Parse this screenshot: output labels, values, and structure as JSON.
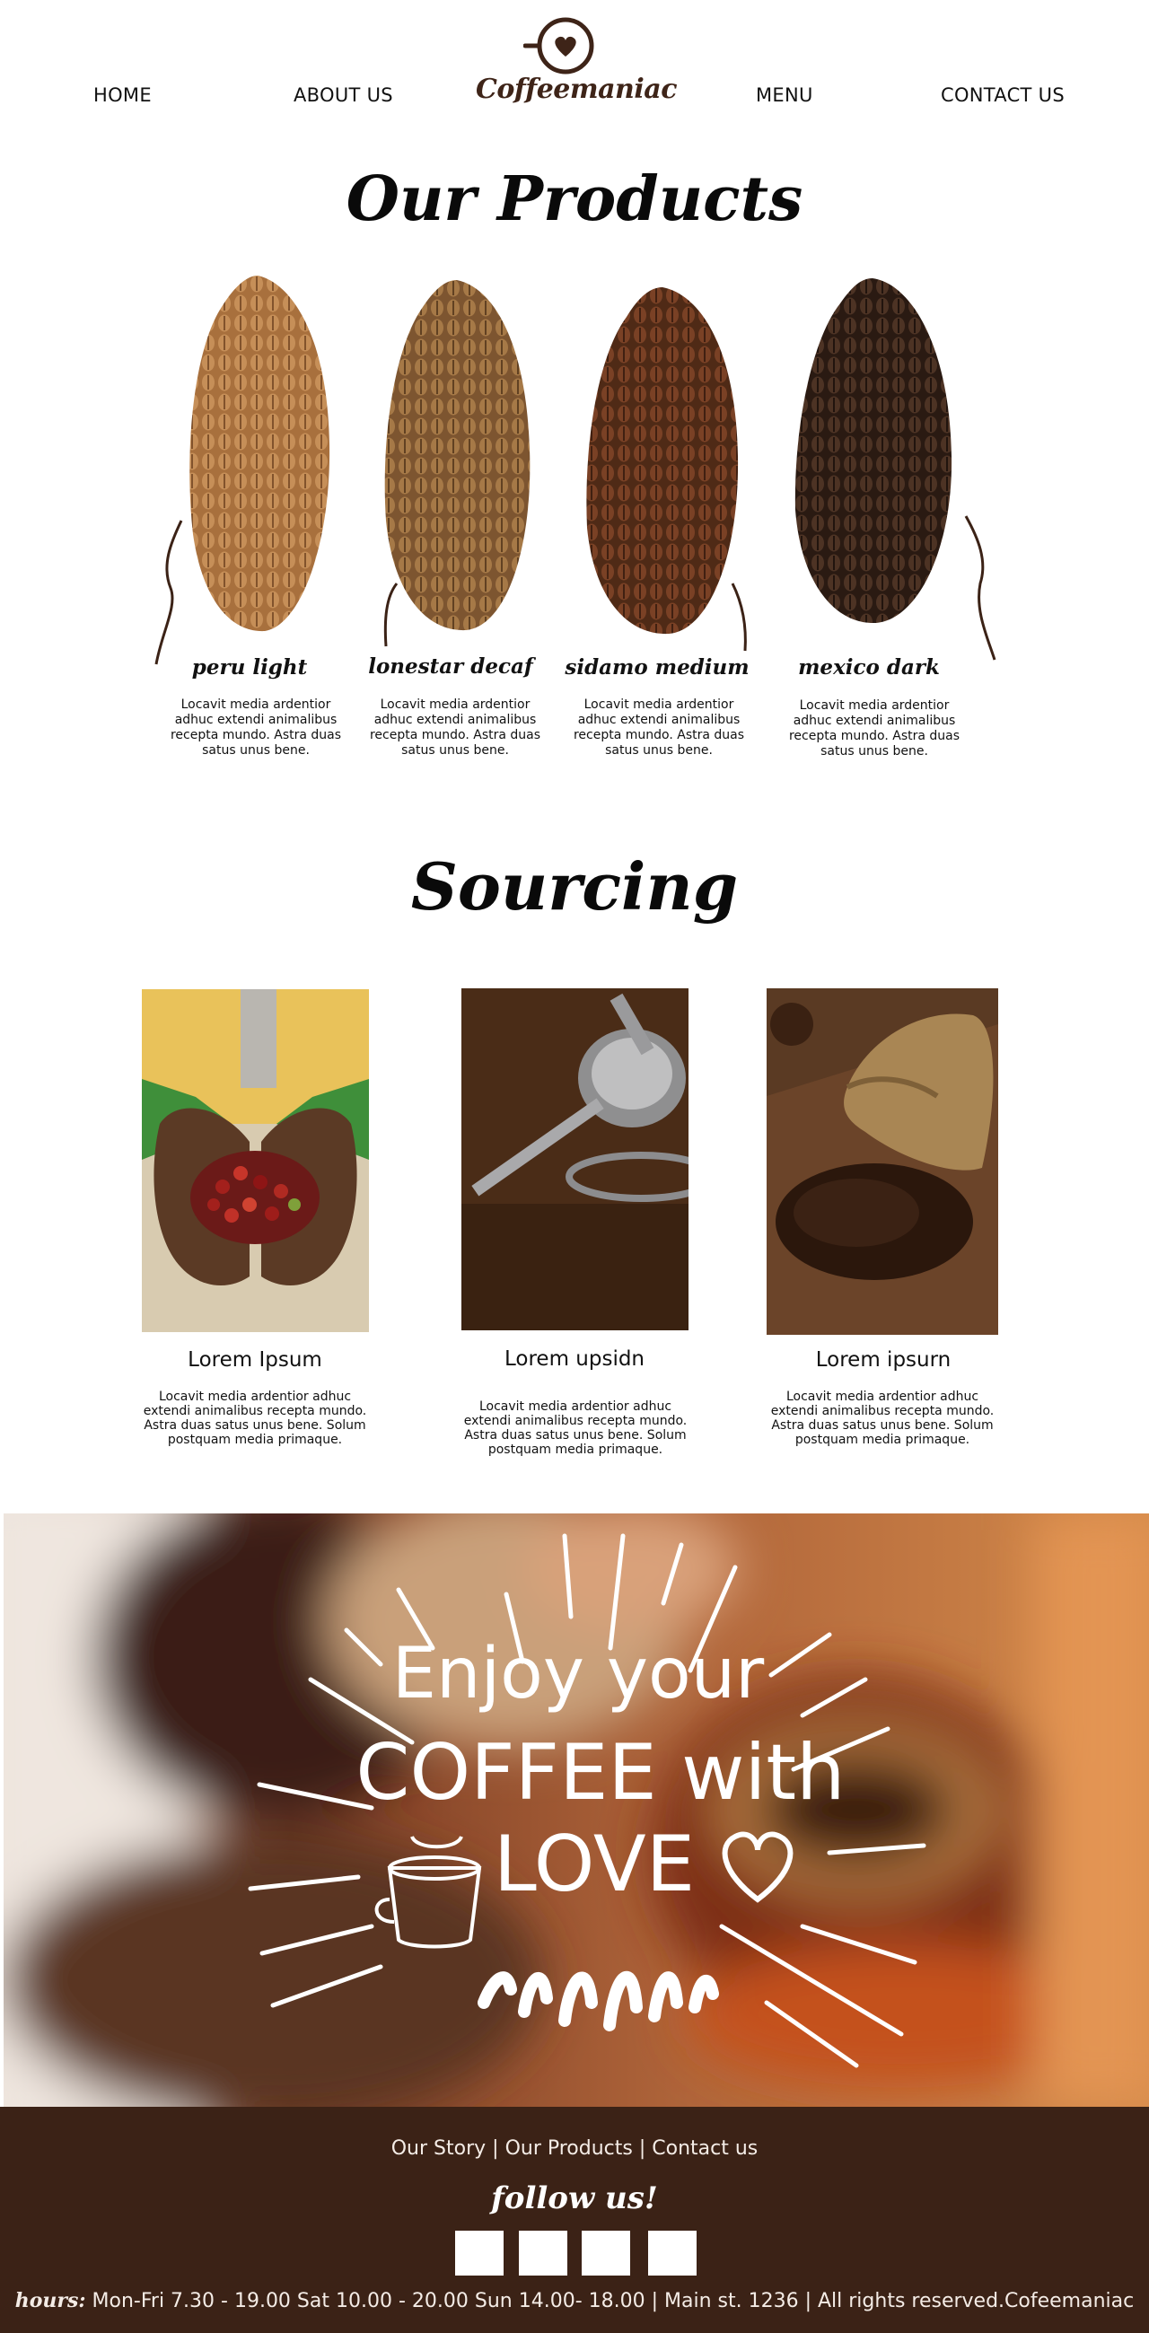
{
  "nav": {
    "home": "HOME",
    "about": "ABOUT US",
    "menu": "MENU",
    "contact": "CONTACT US",
    "logo_text": "Coffeemaniac"
  },
  "products": {
    "title": "Our Products",
    "items": [
      {
        "name": "peru light",
        "desc": "Locavit media ardentior adhuc extendi animalibus recepta mundo. Astra duas satus unus bene."
      },
      {
        "name": "lonestar decaf",
        "desc": "Locavit media ardentior adhuc extendi animalibus recepta mundo. Astra duas satus unus bene."
      },
      {
        "name": "sidamo medium",
        "desc": "Locavit media ardentior adhuc extendi animalibus recepta mundo. Astra duas satus unus bene."
      },
      {
        "name": "mexico dark",
        "desc": "Locavit media ardentior adhuc extendi animalibus recepta mundo. Astra duas satus unus bene."
      }
    ]
  },
  "sourcing": {
    "title": "Sourcing",
    "items": [
      {
        "title": "Lorem Ipsum",
        "desc": "Locavit media ardentior adhuc extendi animalibus recepta mundo. Astra duas satus unus bene. Solum postquam media primaque."
      },
      {
        "title": "Lorem upsidn",
        "desc": "Locavit media ardentior adhuc extendi animalibus recepta mundo. Astra duas satus unus bene. Solum postquam media primaque."
      },
      {
        "title": "Lorem ipsurn",
        "desc": "Locavit media ardentior adhuc extendi animalibus recepta mundo. Astra duas satus unus bene. Solum postquam media primaque."
      }
    ]
  },
  "banner": {
    "line1": "Enjoy your",
    "line2": "COFFEE with",
    "line3": "LOVE"
  },
  "footer": {
    "link_story": "Our Story",
    "link_products": "Our Products",
    "link_contact": "Contact us",
    "separator": "|",
    "follow": "follow us!",
    "hours_label": "hours:",
    "hours_text": "Mon-Fri 7.30 - 19.00 Sat  10.00 - 20.00 Sun  14.00- 18.00   |  Main st. 1236 | All rights reserved.Cofeemaniac"
  },
  "colors": {
    "footer_bg": "#3b2216",
    "logo_brown": "#3e2418",
    "text_dark": "#111111",
    "footer_text": "#f4ece6"
  },
  "icons": [
    "coffee-cup-heart-logo-icon",
    "social-icon"
  ]
}
